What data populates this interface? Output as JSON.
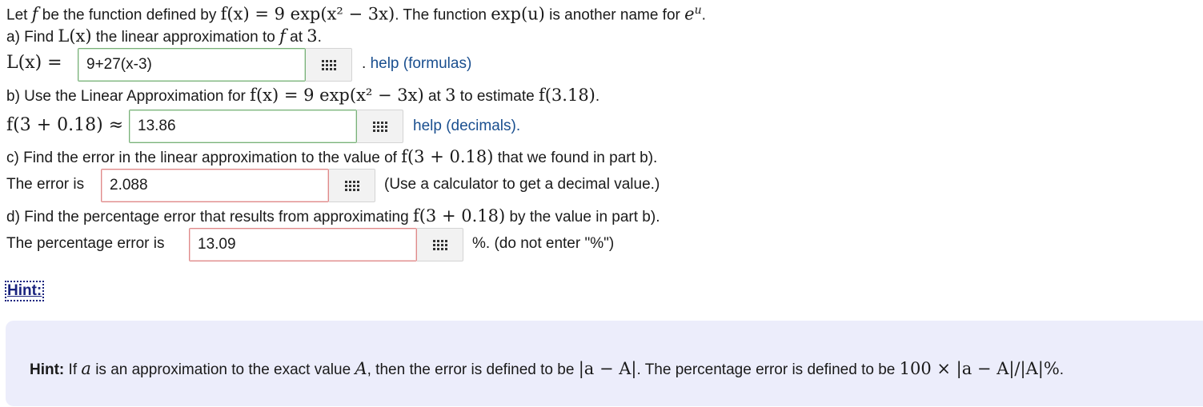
{
  "intro": {
    "text1": "Let ",
    "f": "f",
    "text2": " be the function defined by ",
    "func_lhs": "f(x)",
    "eq": " = ",
    "func_rhs": "9 exp(x² − 3x)",
    "text3": ". The function ",
    "expu": "exp(u)",
    "text4": " is another name for ",
    "eu_base": "e",
    "eu_exp": "u",
    "text5": "."
  },
  "part_a": {
    "prompt1": "a) Find ",
    "Lx": "L(x)",
    "prompt2": " the linear approximation to ",
    "f": "f",
    "prompt3": " at ",
    "point": "3",
    "prompt4": ".",
    "label": "L(x) =",
    "value": "9+27(x-3)",
    "status": "correct",
    "help_prefix": ". ",
    "help_label": "help (formulas)"
  },
  "part_b": {
    "prompt1": "b) Use the Linear Approximation for ",
    "func": "f(x) = 9 exp(x² − 3x)",
    "prompt2": " at ",
    "point": "3",
    "prompt3": " to estimate ",
    "target": "f(3.18)",
    "prompt4": ".",
    "label": "f(3 + 0.18) ≈",
    "value": "13.86",
    "status": "correct",
    "help_label": "help (decimals)."
  },
  "part_c": {
    "prompt1": "c) Find the error in the linear approximation to the value of ",
    "expr": "f(3 + 0.18)",
    "prompt2": " that we found in part b).",
    "label": "The error is",
    "value": "2.088",
    "status": "incorrect",
    "note": "(Use a calculator to get a decimal value.)"
  },
  "part_d": {
    "prompt1": "d) Find the percentage error that results from approximating ",
    "expr": "f(3 + 0.18)",
    "prompt2": " by the value in part b).",
    "label": "The percentage error is",
    "value": "13.09",
    "status": "incorrect",
    "note": "%. (do not enter \"%\")"
  },
  "hint": {
    "toggle_label": "Hint:",
    "bold_label": "Hint:",
    "text1": " If ",
    "a": "a",
    "text2": " is an approximation to the exact value ",
    "A": "A",
    "text3": ", then the error is defined to be ",
    "error_expr": "|a − A|",
    "text4": ". The percentage error is defined to be ",
    "pct_expr": "100 × |a − A|/|A|%",
    "text5": "."
  },
  "colors": {
    "correct_border": "#7ab07a",
    "incorrect_border": "#e08a8a",
    "link": "#1a4f8f",
    "hint_toggle": "#1a237e",
    "hint_bg": "#ecedfb"
  }
}
